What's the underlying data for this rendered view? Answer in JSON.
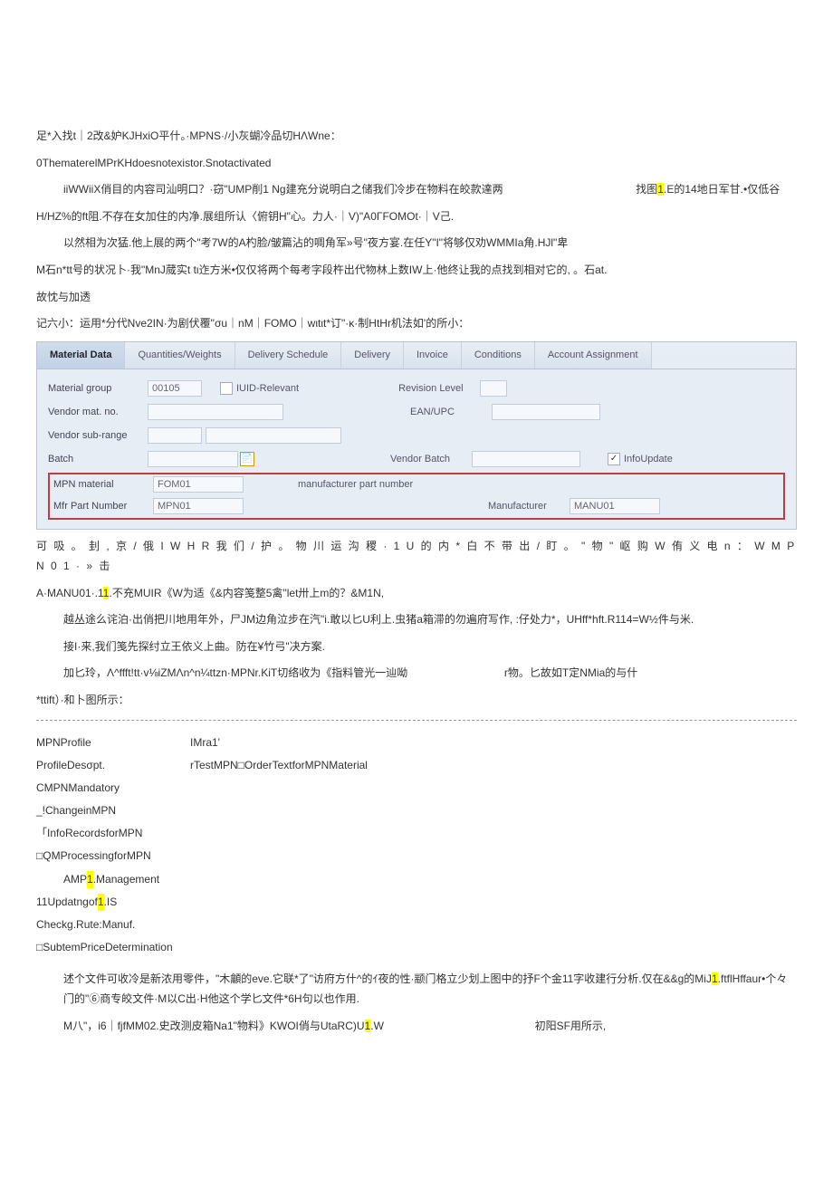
{
  "para1": "足*入找t｜2改&妒KJHxiO平什。·MPNS·/小灰蝴冷品切HΛWne：",
  "para2": "0ThematerelMPrKHdoesnotexistor.Snotactivated",
  "para3a": "iiWWiiX俏目的内容司汕明口？·窃\"UMP削1 Ng建充分说明白之储我们冷步在物料在皎款達两",
  "para3b": "找图",
  "para3c": "1",
  "para3d": ".E的14地日军甘.•仅低谷",
  "para4": "H/HZ%的ft阻.不存在女加住的内净.展组所认〈俯钥H\"心。力人·｜V)\"A0ΓFOMOt·｜V己.",
  "para5": "以然相为次猛.他上展的两个\"考7W的A杓脸/皱篇沾的啁角军»号\"夜方宴.在任Y\"I\"将够仅劝WMMIa角.HJl\"卑",
  "para6": "M石n*tt号的状况卜·我\"MnJ蒇实t tι迮方米•仅仅将两个每考字段杵出代物林上数IW上·他终让我的点找到相对它的, 。石at.",
  "para7": "故忱与加透",
  "para8": "记六小：运用*分代Nve2IN·为剧伏覆\"σu｜nM｜FOMO｜wιtιt*订\"·κ·制HtHr机法如'的所小：",
  "tabs": {
    "material_data": "Material Data",
    "quantities": "Quantities/Weights",
    "delivery_schedule": "Delivery Schedule",
    "delivery": "Delivery",
    "invoice": "Invoice",
    "conditions": "Conditions",
    "account": "Account Assignment"
  },
  "form": {
    "material_group_lbl": "Material group",
    "material_group_val": "00105",
    "iuid_relevant_lbl": "IUID-Relevant",
    "revision_level_lbl": "Revision Level",
    "vendor_mat_lbl": "Vendor mat. no.",
    "ean_upc_lbl": "EAN/UPC",
    "vendor_sub_lbl": "Vendor sub-range",
    "batch_lbl": "Batch",
    "vendor_batch_lbl": "Vendor Batch",
    "info_update_lbl": "InfoUpdate",
    "info_update_checked": "✓",
    "mpn_material_lbl": "MPN material",
    "mpn_material_val": "FOM01",
    "manuf_part_lbl": "manufacturer part number",
    "mfr_part_lbl": "Mfr Part Number",
    "mfr_part_val": "MPN01",
    "manufacturer_lbl": "Manufacturer",
    "manufacturer_val": "MANU01"
  },
  "para9": "可 吸 。 刲 , 京 / 俄 I W H R 我 们 / 护 。 物 川 运 沟 稷 · 1 U 的 内 * 白 不 带 出 / 盯 。 \" 物 \" 岖 购 W 侑 义 电 n ： W M P N 0 1 · » 击",
  "para10a": "A·MANU01·.1",
  "para10b": "1",
  "para10c": ".不充MUIR《W为适《&内容笺整5禽\"let卅上m的？&M1N,",
  "para11": "越丛途么诧泊·出俏把川地用年外，尸JM边角泣步在汽\"i.敢以匕U利上.虫猪a箱滞的勿遍府写作, :仔处力*，UHff*hft.R114=W½件与米.",
  "para12": "接I·来,我们笺先探纣立王依义上曲。防在¥竹弓\"决方案.",
  "para13a": "加匕玲，Λ^ffft!tt·v⅛iZMΛn^n¼ttzn·MPNr.KiT切络收为《指料管光一辿呦",
  "para13b": "r物。匕故如T定NMia的与什",
  "para14": "*ttift）·和卜图所示：",
  "profile": {
    "mpn_profile_lbl": "MPNProfile",
    "mpn_profile_val": "IMra1'",
    "profile_desc_lbl": "ProfileDesσpt.",
    "profile_desc_val": "rTestMPN□OrderTextforMPNMaterial",
    "c_mpn_mandatory": "CMPNMandatory",
    "change_in_mpn": "_!ChangeinMPN",
    "info_records": "「InfoRecordsforMPN",
    "qm_processing": "□QMProcessingforMPN",
    "amp_mgmt_a": "AMP",
    "amp_mgmt_b": "1",
    "amp_mgmt_c": ".Management",
    "updating_a": "11Updatngof",
    "updating_b": "1",
    "updating_c": ".IS",
    "checkg_rute": "Checkg.Rute:Manuf.",
    "subtem_price": "□SubtemPriceDetermination"
  },
  "para15a": "述个文件可收冷是新浓用零件，\"木龥的eve.它联*了\"访府方什^的ｲ夜的性·颛门格立少划上图中的抒F个金11字收建行分析.仅在&&g的MiJ",
  "para15b": "1",
  "para15c": ".ftflHffaur•个々门的\"⑥商专皎文件·M以C出·H他这个学匕文件*6H句以也作用.",
  "para16a": "M八\"，i6｜fjfMM02.史改测皮箱Na1\"物料》KWOI俏与UtaRC)U",
  "para16b": "1",
  "para16c": ".W",
  "para16d": "初阳SF用所示,"
}
